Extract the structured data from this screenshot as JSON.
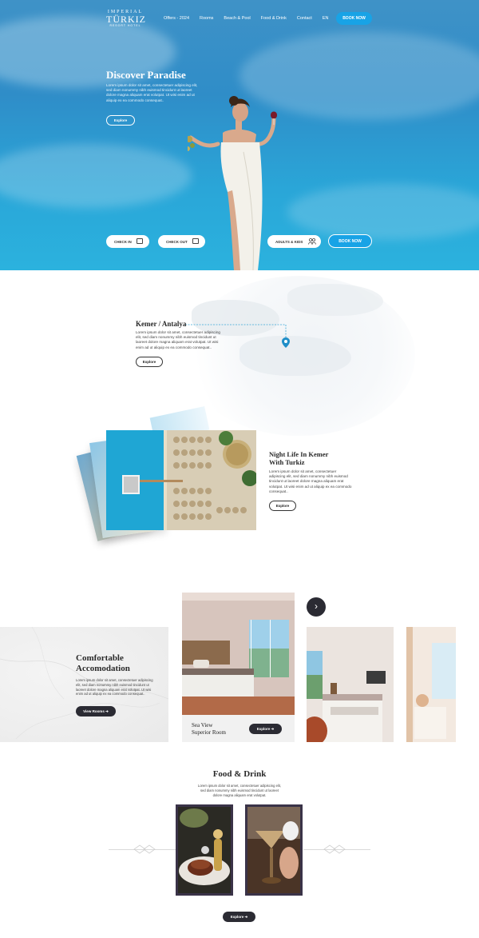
{
  "logo": {
    "line1": "IMPERIAL",
    "line2": "TÜRKIZ",
    "line3": "RESORT HOTEL"
  },
  "nav": {
    "items": [
      "Offers - 2024",
      "Rooms",
      "Beach & Pool",
      "Food & Drink",
      "Contact",
      "EN"
    ],
    "book": "BOOK NOW"
  },
  "hero": {
    "title": "Discover Paradise",
    "text": "Lorem ipsum dolor sit amet, consectetuer adipiscing elit, sed diam nonummy nibh euismod tincidunt ut laoreet dolore magna aliquam erat volutpat. Ut wisi enim ad ut aliquip ex ea commodo consequat..",
    "explore": "Explore"
  },
  "booking": {
    "check_in": "CHECK IN",
    "check_out": "CHECK OUT",
    "guests": "ADULTS & KIDS",
    "book": "BOOK NOW"
  },
  "location": {
    "title": "Kemer / Antalya",
    "text": "Lorem ipsum dolor sit amet, consectetuer adipiscing elit, sed diam nonummy nibh euismod tincidunt ut laoreet dolore magna aliquam erat volutpat. Ut wisi enim ad ut aliquip ex ea commodo consequat..",
    "explore": "Explore"
  },
  "nightlife": {
    "title_line1": "Night Life In Kemer",
    "title_line2": "With Turkiz",
    "text": "Lorem ipsum dolor sit amet, consectetuer adipiscing elit, sed diam nonummy nibh euismod tincidunt ut laoreet dolore magna aliquam erat volutpat. Ut wisi enim ad ut aliquip ex ea commodo consequat..",
    "explore": "Explore"
  },
  "accommodation": {
    "title_line1": "Comfortable",
    "title_line2": "Accomodation",
    "text": "Lorem ipsum dolor sit amet, consectetuer adipiscing elit, sed diam nonummy nibh euismod tincidunt ut laoreet dolore magna aliquam erat volutpat. Ut wisi enim ad ut aliquip ex ea commodo consequat..",
    "view_rooms": "View Rooms ➔",
    "room_line1": "Sea View",
    "room_line2": "Superior Room",
    "room_explore": "Explore ➔",
    "next": "›"
  },
  "food": {
    "title": "Food & Drink",
    "text": "Lorem ipsum dolor sit amet, consectetuer adipiscing elit, sed diam nonummy nibh euismod tincidunt ut laoreet dolore magna aliquam erat volutpat.",
    "explore": "Explore ➔"
  },
  "colors": {
    "accent": "#18a3e6",
    "dark": "#2b2b33",
    "food_frame": "#3a3348"
  },
  "icons": [
    "calendar-icon",
    "calendar-icon",
    "people-icon",
    "map-pin-icon",
    "chevron-right-icon",
    "arrow-right-icon"
  ]
}
